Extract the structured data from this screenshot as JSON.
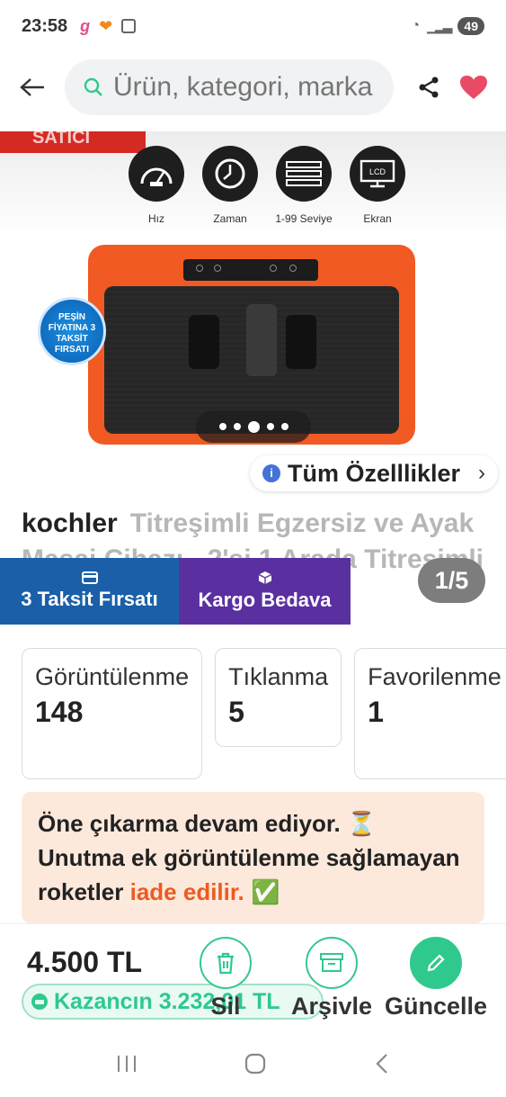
{
  "status_bar": {
    "time": "23:58",
    "battery": "49"
  },
  "search": {
    "placeholder": "Ürün, kategori, marka ara"
  },
  "gallery": {
    "seller_ribbon": "SATICI",
    "features": [
      "Hız",
      "Zaman",
      "1-99 Seviye",
      "Ekran"
    ],
    "lcd_label": "LCD",
    "badge": "PEŞİN FİYATINA 3 TAKSİT FIRSATI",
    "all_features": "Tüm Özelllikler",
    "counter": "1/5",
    "page_count": 5,
    "active_page": 3
  },
  "product": {
    "brand": "kochler",
    "title": "Titreşimli Egzersiz ve Ayak Masaj Cihazı - 2'si 1 Arada Titreşimli Egzersiz Aleti Giyimi"
  },
  "promos": {
    "installment": "3 Taksit Fırsatı",
    "shipping": "Kargo Bedava"
  },
  "stats": [
    {
      "label": "Görüntülenme",
      "value": "148"
    },
    {
      "label": "Tıklanma",
      "value": "5"
    },
    {
      "label": "Favorilenme",
      "value": "1"
    }
  ],
  "notice": {
    "line1": "Öne çıkarma devam ediyor. ⏳",
    "line2": "Unutma ek görüntülenme sağlamayan roketler ",
    "highlight": "iade edilir.",
    "check": " ✅"
  },
  "bottom": {
    "price": "4.500 TL",
    "earning": "Kazancın 3.232,01 TL",
    "delete": "Sil",
    "archive": "Arşivle",
    "update": "Güncelle"
  },
  "colors": {
    "accent_green": "#2fc98e",
    "accent_orange": "#ee5a20",
    "heart": "#e94a66"
  }
}
